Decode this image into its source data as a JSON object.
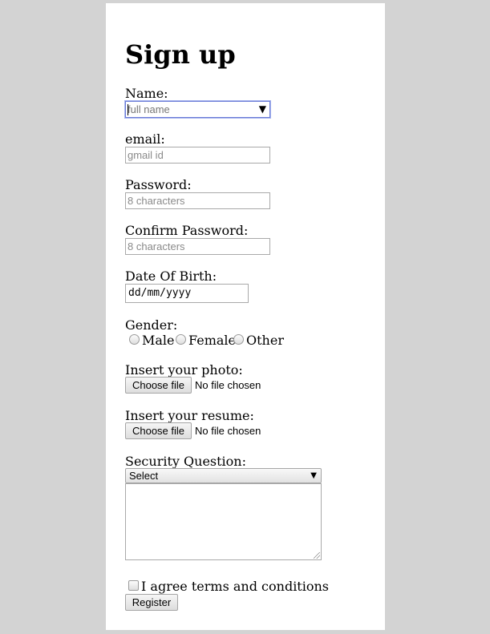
{
  "form": {
    "title": "Sign up",
    "name": {
      "label": "Name:",
      "placeholder": "full name"
    },
    "email": {
      "label": "email:",
      "placeholder": "gmail id"
    },
    "password": {
      "label": "Password:",
      "placeholder": "8 characters"
    },
    "confirm_password": {
      "label": "Confirm Password:",
      "placeholder": "8 characters"
    },
    "dob": {
      "label": "Date Of Birth:",
      "value": "dd/mm/yyyy"
    },
    "gender": {
      "label": "Gender:",
      "options": [
        "Male",
        "Female",
        "Other"
      ]
    },
    "photo": {
      "label": "Insert your photo:",
      "button": "Choose file",
      "status": "No file chosen"
    },
    "resume": {
      "label": "Insert your resume:",
      "button": "Choose file",
      "status": "No file chosen"
    },
    "security": {
      "label": "Security Question:",
      "selected": "Select"
    },
    "agree": {
      "label": "I agree terms and conditions"
    },
    "register": {
      "label": "Register"
    }
  },
  "colors": {
    "page_background": "#d3d3d3",
    "card_background": "#ffffff",
    "focus_border": "#6a7bd6"
  },
  "icons": {
    "dropdown": "chevron-down-icon",
    "resize": "resize-grip-icon"
  }
}
